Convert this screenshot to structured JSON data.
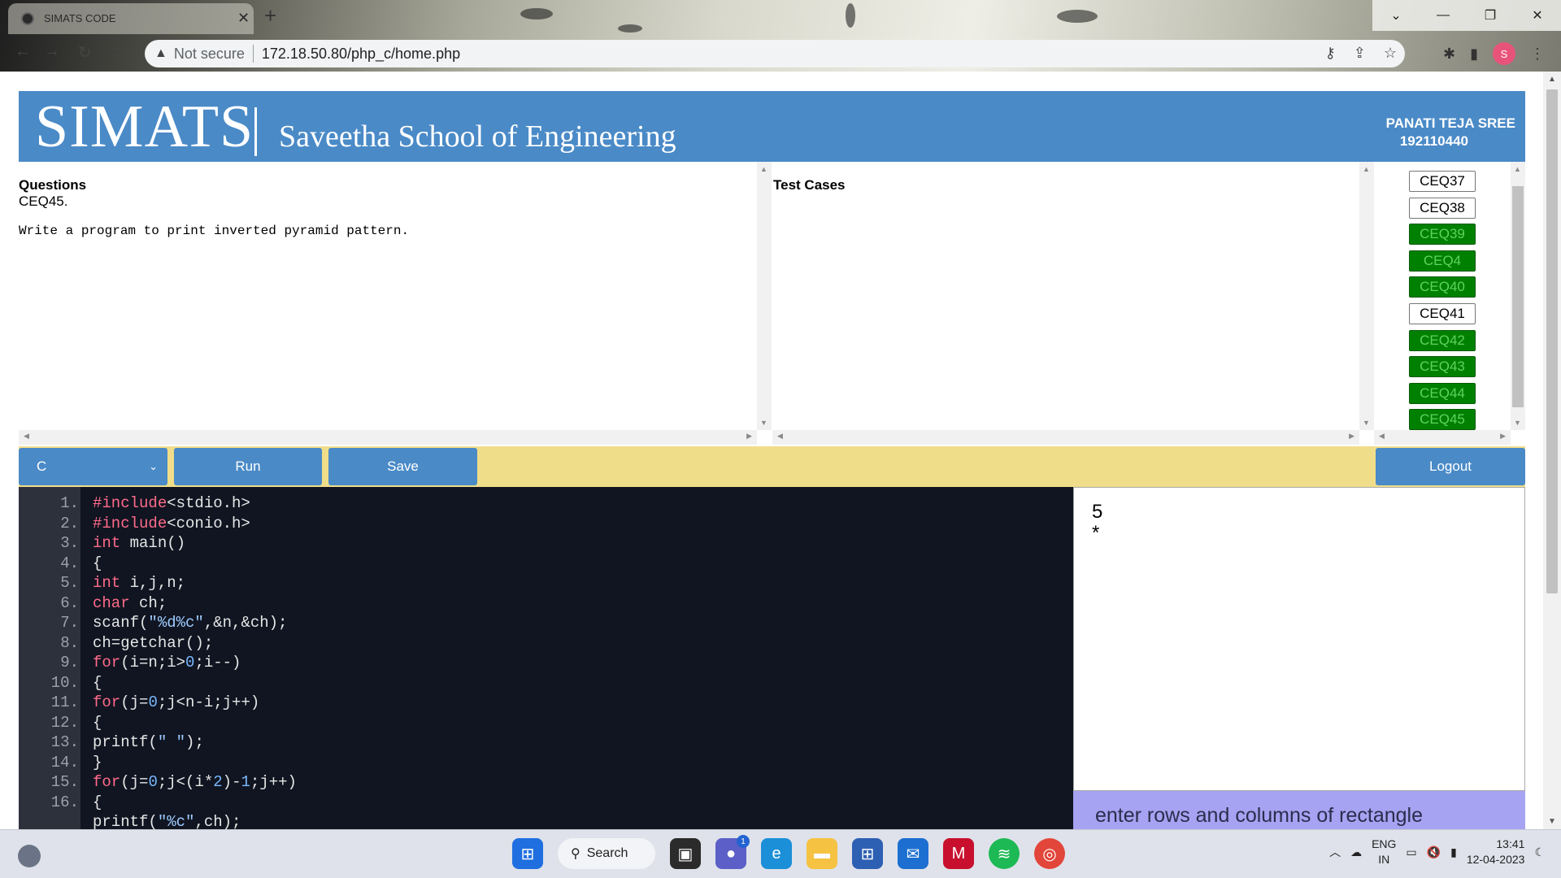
{
  "browser": {
    "tab_title": "SIMATS CODE",
    "not_secure": "Not secure",
    "url": "172.18.50.80/php_c/home.php",
    "profile_initial": "S"
  },
  "header": {
    "brand": "SIMATS",
    "school": "Saveetha School of Engineering",
    "user_name": "PANATI TEJA SREE",
    "user_id": "192110440"
  },
  "questions": {
    "title": "Questions",
    "code": "CEQ45.",
    "text": "Write a program to print inverted pyramid pattern."
  },
  "test_cases": {
    "title": "Test Cases"
  },
  "question_list": [
    {
      "label": "CEQ37",
      "status": "plain"
    },
    {
      "label": "CEQ38",
      "status": "plain"
    },
    {
      "label": "CEQ39",
      "status": "done"
    },
    {
      "label": "CEQ4",
      "status": "done"
    },
    {
      "label": "CEQ40",
      "status": "done"
    },
    {
      "label": "CEQ41",
      "status": "plain"
    },
    {
      "label": "CEQ42",
      "status": "done"
    },
    {
      "label": "CEQ43",
      "status": "done"
    },
    {
      "label": "CEQ44",
      "status": "done"
    },
    {
      "label": "CEQ45",
      "status": "done"
    }
  ],
  "toolbar": {
    "language": "C",
    "run": "Run",
    "save": "Save",
    "logout": "Logout"
  },
  "editor": {
    "line_numbers": [
      "1.",
      "2.",
      "3.",
      "4.",
      "5.",
      "6.",
      "7.",
      "8.",
      "9.",
      "10.",
      "11.",
      "12.",
      "13.",
      "14.",
      "15.",
      "16."
    ],
    "lines": [
      "#include<stdio.h>",
      "#include<conio.h>",
      "int main()",
      "{",
      "int i,j,n;",
      "char ch;",
      "scanf(\"%d%c\",&n,&ch);",
      "ch=getchar();",
      "for(i=n;i>0;i--)",
      "{",
      "for(j=0;j<n-i;j++)",
      "{",
      "printf(\" \");",
      "}",
      "for(j=0;j<(i*2)-1;j++)",
      "{",
      "printf(\"%c\",ch);"
    ]
  },
  "output": {
    "lines": [
      "5",
      "*"
    ],
    "input_prompt": "enter rows and columns of rectangle"
  },
  "taskbar": {
    "search": "Search",
    "chat_badge": "1",
    "lang_top": "ENG",
    "lang_bottom": "IN",
    "time": "13:41",
    "date": "12-04-2023"
  },
  "colors": {
    "header_blue": "#4a8ac7",
    "toolbar_yellow": "#f0dd8a",
    "done_green": "#008000",
    "editor_bg": "#101521",
    "input_purple": "#a6a3f2"
  }
}
